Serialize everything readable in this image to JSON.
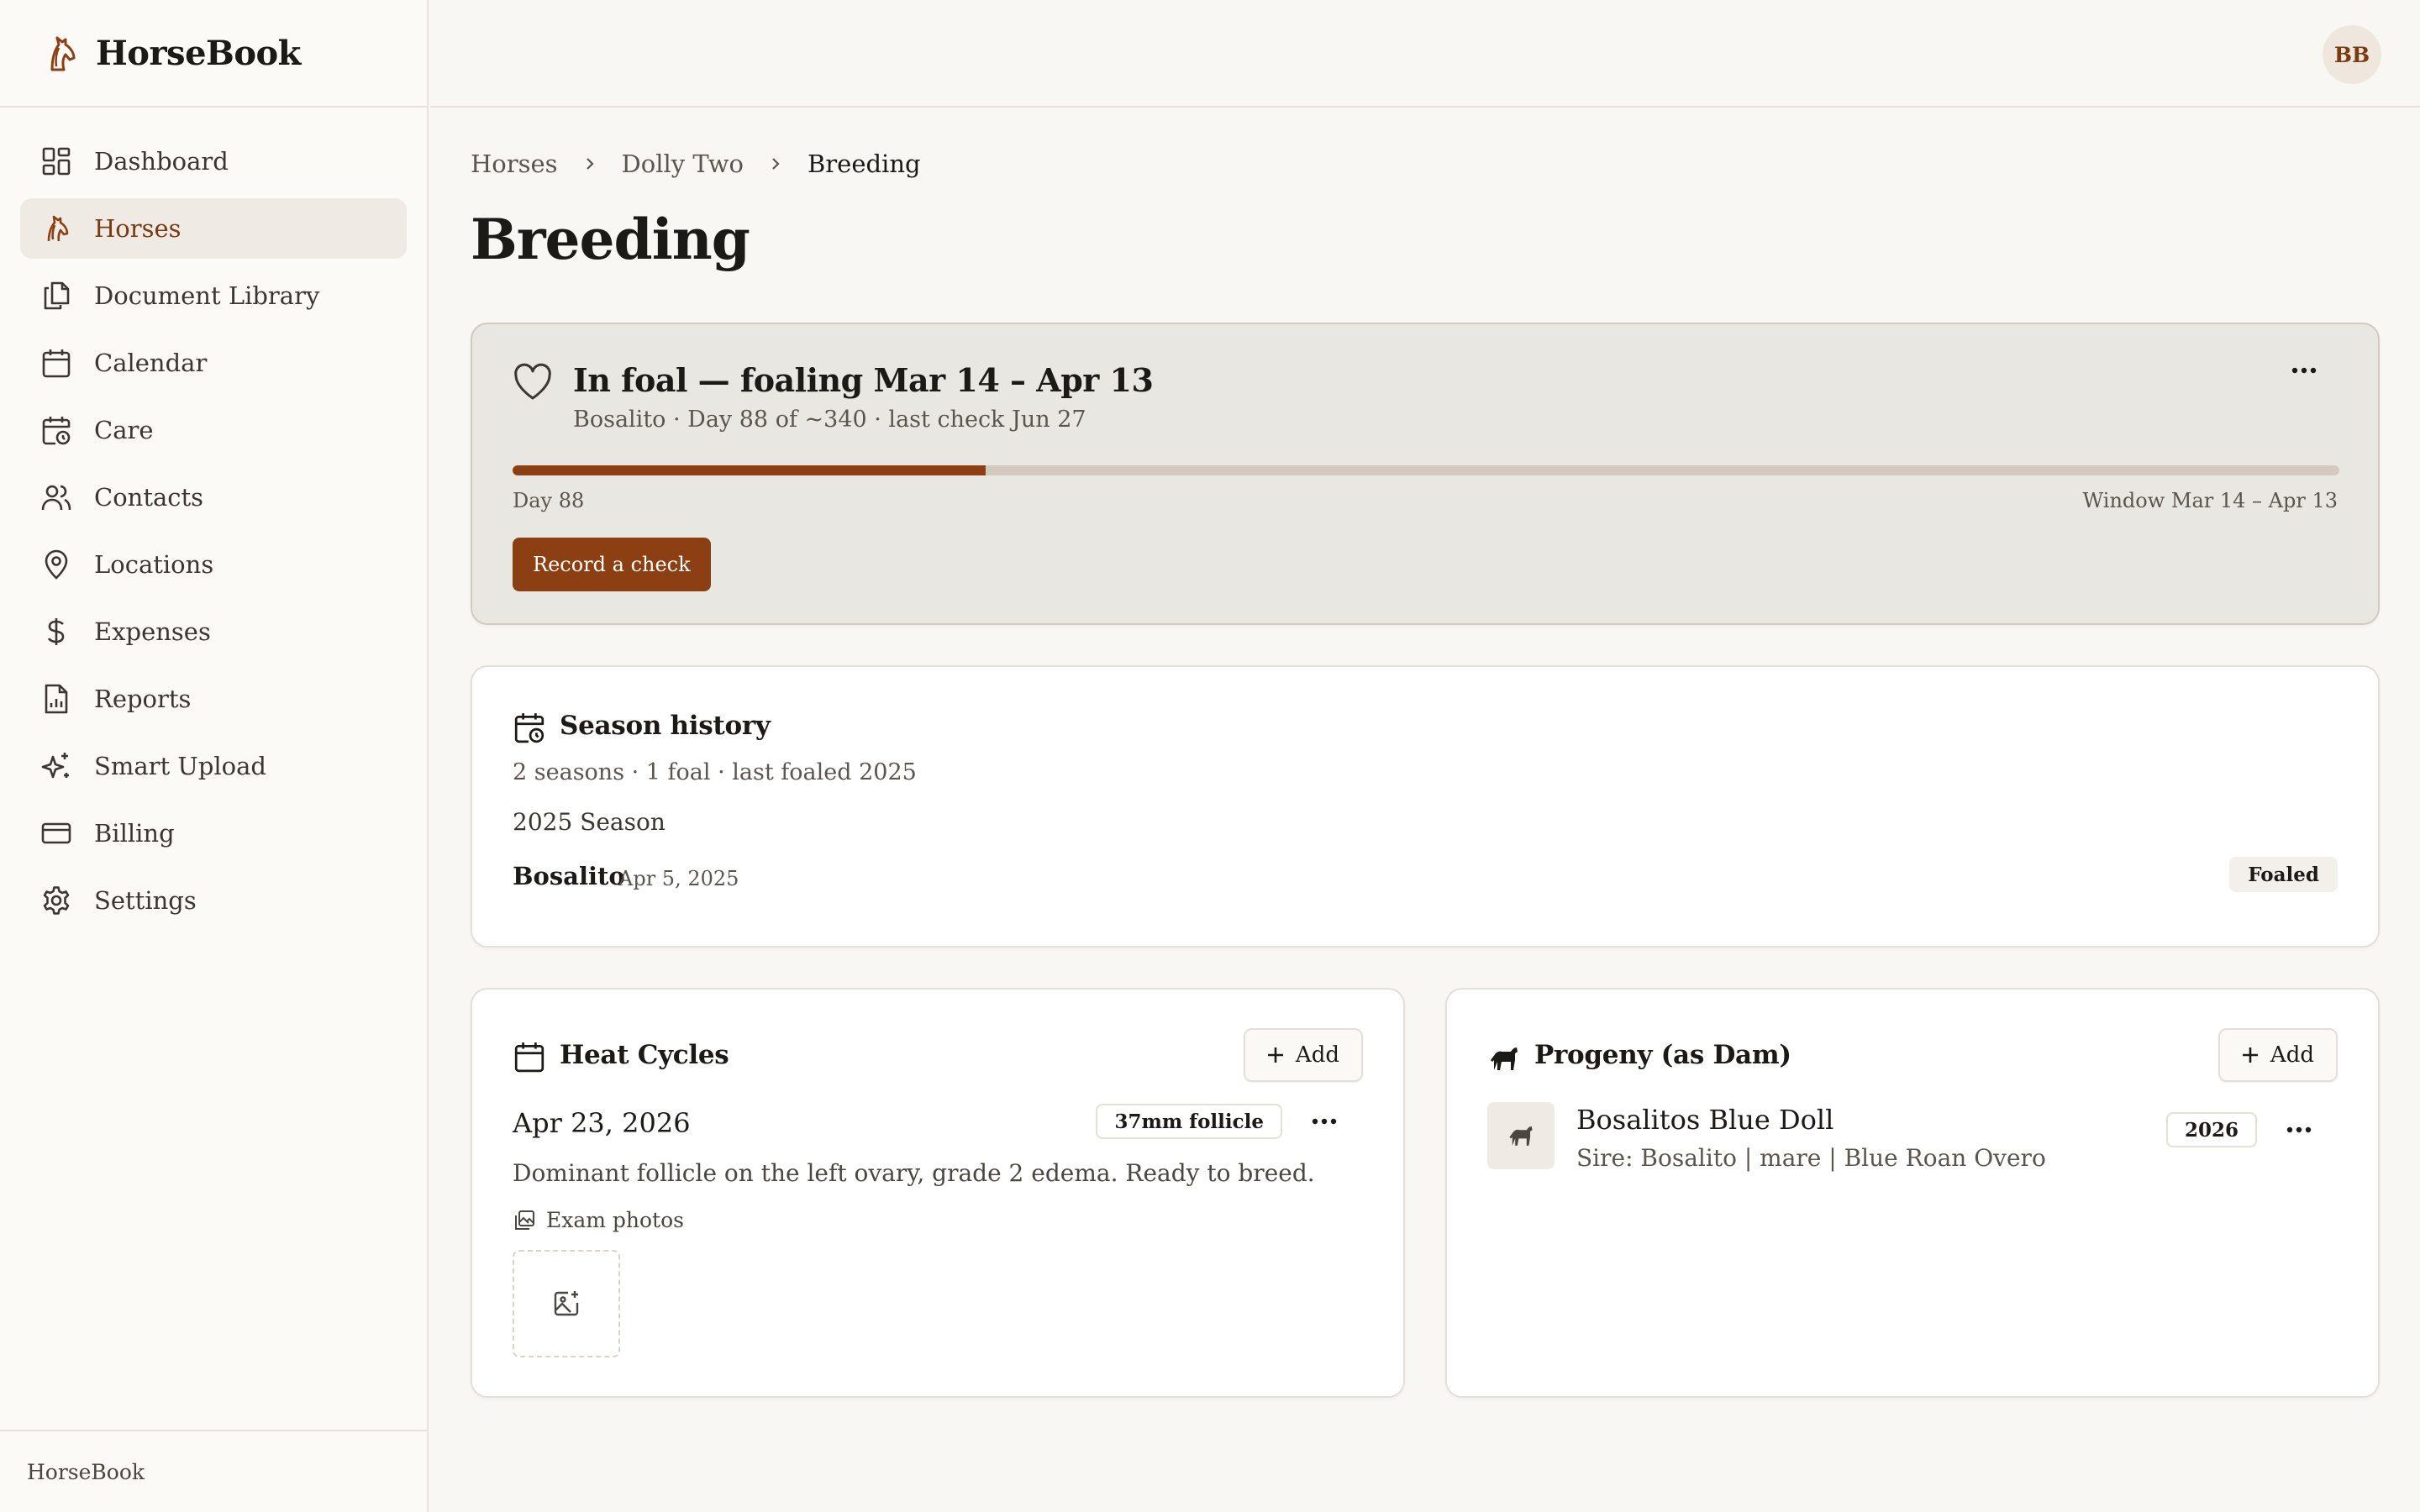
{
  "app": {
    "name": "HorseBook",
    "footer": "HorseBook",
    "user_initials": "BB",
    "accent": "#8b3f12"
  },
  "sidebar": {
    "items": [
      {
        "label": "Dashboard",
        "icon": "dashboard-icon"
      },
      {
        "label": "Horses",
        "icon": "horse-icon",
        "active": true
      },
      {
        "label": "Document Library",
        "icon": "documents-icon"
      },
      {
        "label": "Calendar",
        "icon": "calendar-icon"
      },
      {
        "label": "Care",
        "icon": "calendar-clock-icon"
      },
      {
        "label": "Contacts",
        "icon": "users-icon"
      },
      {
        "label": "Locations",
        "icon": "map-pin-icon"
      },
      {
        "label": "Expenses",
        "icon": "dollar-icon"
      },
      {
        "label": "Reports",
        "icon": "report-icon"
      },
      {
        "label": "Smart Upload",
        "icon": "sparkles-icon"
      },
      {
        "label": "Billing",
        "icon": "credit-card-icon"
      },
      {
        "label": "Settings",
        "icon": "gear-icon"
      }
    ]
  },
  "breadcrumb": [
    "Horses",
    "Dolly Two",
    "Breeding"
  ],
  "page": {
    "title": "Breeding"
  },
  "foal_status": {
    "title": "In foal — foaling Mar 14 – Apr 13",
    "subtitle": "Bosalito · Day 88 of ~340 · last check Jun 27",
    "progress_fraction": 0.259,
    "progress_left": "Day 88",
    "progress_right": "Window Mar 14 – Apr 13",
    "record_button": "Record a check"
  },
  "season_history": {
    "title": "Season history",
    "summary": "2 seasons · 1 foal · last foaled 2025",
    "season_label": "2025 Season",
    "sire": "Bosalito",
    "date": "Apr 5, 2025",
    "status": "Foaled"
  },
  "heat_cycles": {
    "title": "Heat Cycles",
    "add_label": "Add",
    "entry": {
      "date": "Apr 23, 2026",
      "badge": "37mm follicle",
      "note": "Dominant follicle on the left ovary, grade 2 edema. Ready to breed.",
      "photos_label": "Exam photos"
    }
  },
  "progeny": {
    "title": "Progeny (as Dam)",
    "add_label": "Add",
    "entry": {
      "name": "Bosalitos Blue Doll",
      "details": "Sire: Bosalito | mare | Blue Roan Overo",
      "year": "2026"
    }
  }
}
